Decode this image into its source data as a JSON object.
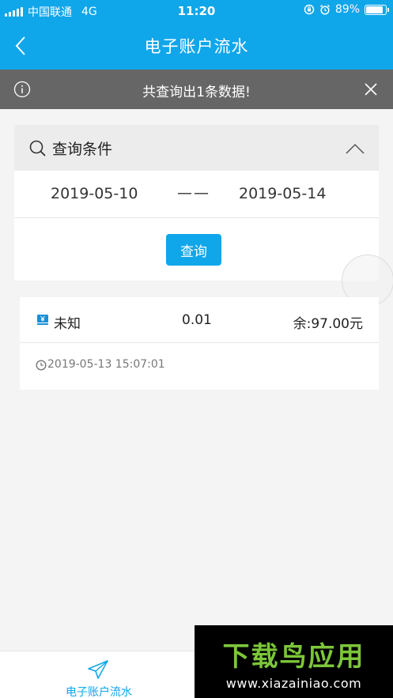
{
  "status_bar": {
    "carrier": "中国联通",
    "network": "4G",
    "time": "11:20",
    "battery": "89%",
    "battery_level": 0.89
  },
  "nav": {
    "title": "电子账户流水"
  },
  "notice": {
    "text": "共查询出1条数据!"
  },
  "query": {
    "title": "查询条件",
    "start_date": "2019-05-10",
    "separator": "——",
    "end_date": "2019-05-14",
    "button_label": "查询"
  },
  "records": [
    {
      "type": "未知",
      "amount": "0.01",
      "balance": "余:97.00元",
      "time": "2019-05-13 15:07:01"
    }
  ],
  "tab_bar": {
    "item_label": "电子账户流水"
  },
  "watermark": {
    "title": "下载鸟应用",
    "url": "www.xiazainiao.com"
  },
  "colors": {
    "primary": "#10a6ea",
    "notice_bg": "#666666",
    "watermark_green": "#7cc63a"
  }
}
